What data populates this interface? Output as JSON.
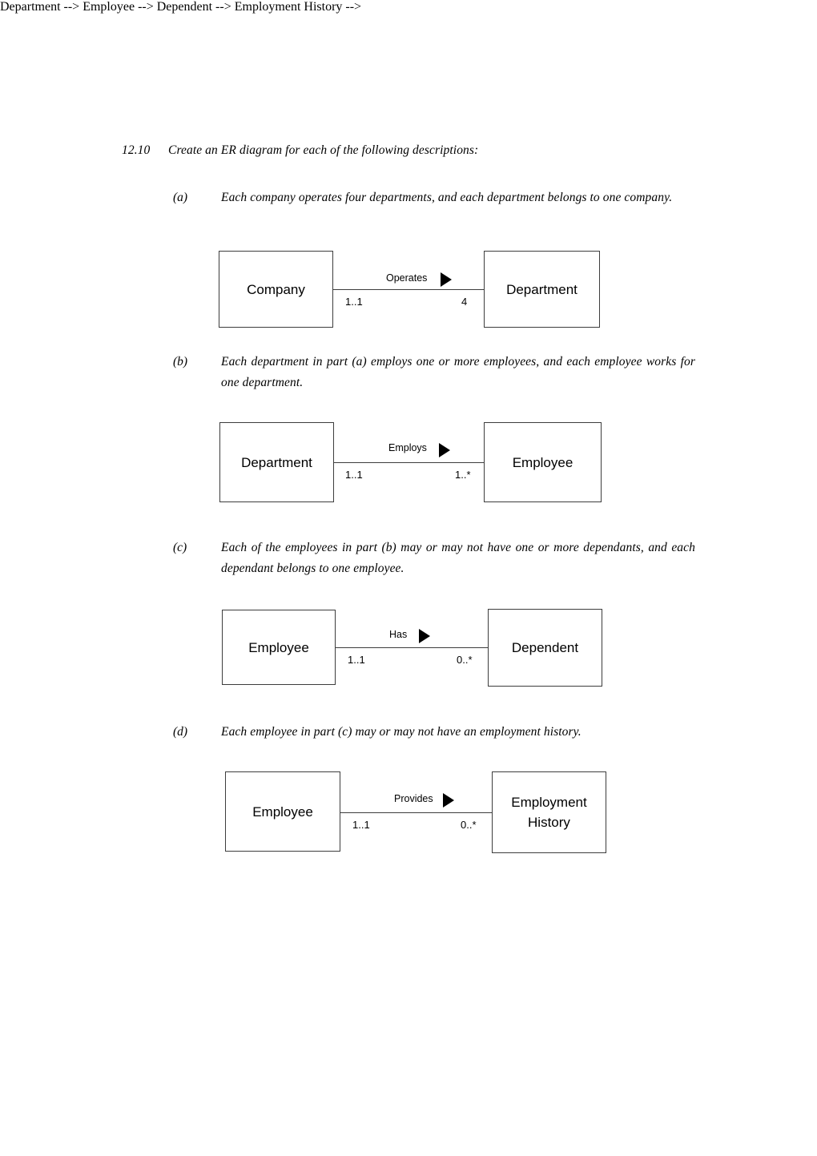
{
  "question": {
    "number": "12.10",
    "text": "Create an ER diagram for each of the following descriptions:"
  },
  "parts": [
    {
      "label": "(a)",
      "text": "Each company operates four departments, and each department belongs to one company."
    },
    {
      "label": "(b)",
      "text": "Each department in part (a) employs one or more employees, and each employee works for one department."
    },
    {
      "label": "(c)",
      "text": "Each of the employees in part (b) may or may not have one or more dependants, and each dependant belongs to one employee."
    },
    {
      "label": "(d)",
      "text": "Each employee in part (c) may or may not have an employment history."
    }
  ],
  "diagrams": [
    {
      "id": "diagram-a",
      "left_entity": "Company",
      "right_entity": "Department",
      "relationship": "Operates",
      "left_cardinality": "1..1",
      "right_cardinality": "4",
      "arrow": "solid-right-triangle"
    },
    {
      "id": "diagram-b",
      "left_entity": "Department",
      "right_entity": "Employee",
      "relationship": "Employs",
      "left_cardinality": "1..1",
      "right_cardinality": "1..*",
      "arrow": "solid-right-triangle"
    },
    {
      "id": "diagram-c",
      "left_entity": "Employee",
      "right_entity": "Dependent",
      "relationship": "Has",
      "left_cardinality": "1..1",
      "right_cardinality": "0..*",
      "arrow": "solid-right-triangle"
    },
    {
      "id": "diagram-d",
      "left_entity": "Employee",
      "right_entity": "Employment\nHistory",
      "relationship": "Provides",
      "left_cardinality": "1..1",
      "right_cardinality": "0..*",
      "arrow": "solid-right-triangle"
    }
  ],
  "colors": {
    "text": "#000000",
    "box_border": "#3d3d3d",
    "background": "#ffffff"
  }
}
